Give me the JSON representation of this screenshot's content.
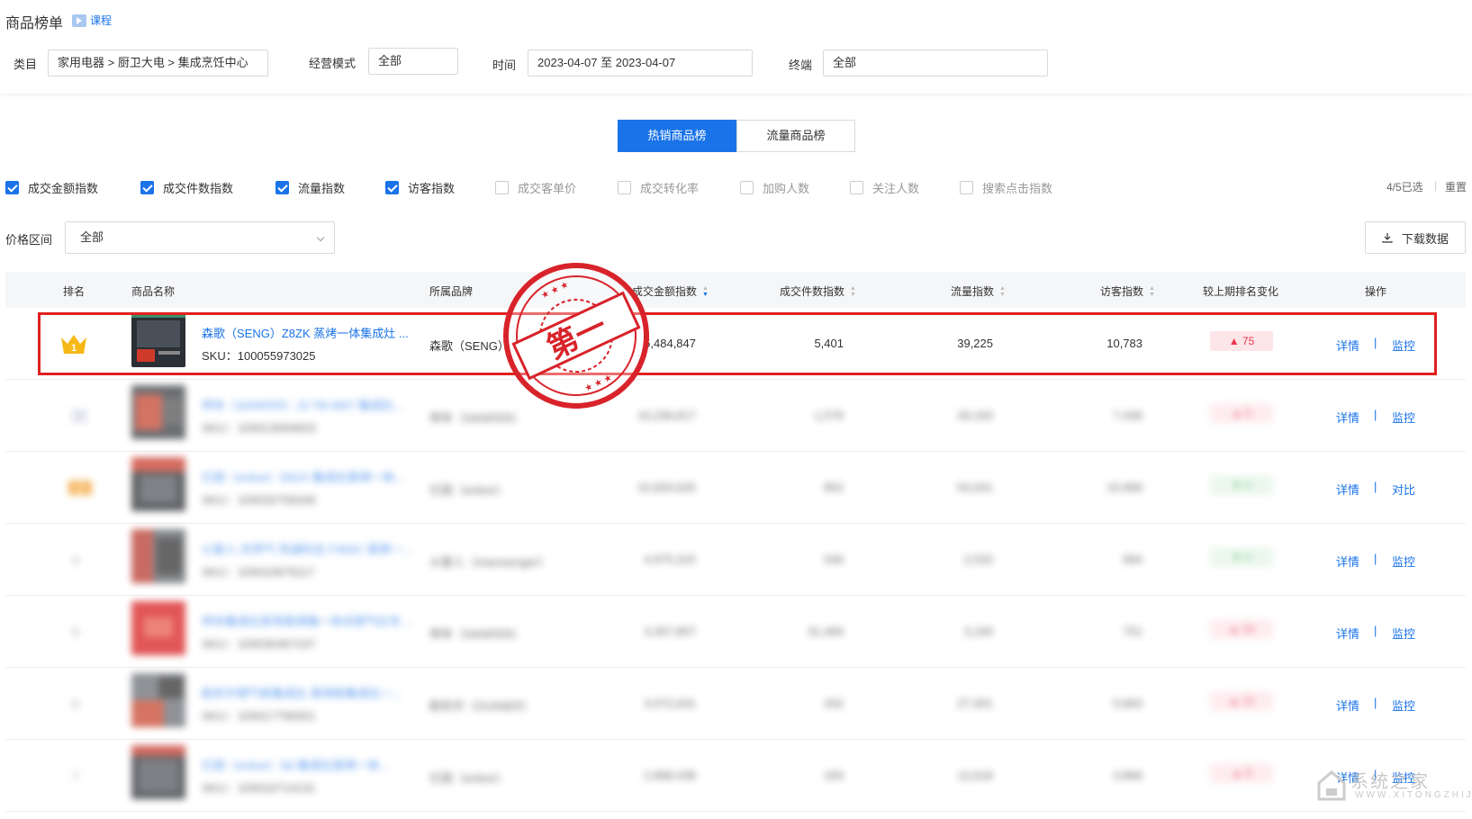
{
  "header": {
    "title": "商品榜单",
    "course_link": "课程"
  },
  "filters": {
    "category_label": "类目",
    "category_value": "家用电器 > 厨卫大电 > 集成烹饪中心",
    "mode_label": "经营模式",
    "mode_value": "全部",
    "time_label": "时间",
    "time_value": "2023-04-07 至 2023-04-07",
    "terminal_label": "终端",
    "terminal_value": "全部"
  },
  "tabs": [
    {
      "label": "热销商品榜",
      "active": true
    },
    {
      "label": "流量商品榜",
      "active": false
    }
  ],
  "metrics": [
    {
      "label": "成交金额指数",
      "checked": true
    },
    {
      "label": "成交件数指数",
      "checked": true
    },
    {
      "label": "流量指数",
      "checked": true
    },
    {
      "label": "访客指数",
      "checked": true
    },
    {
      "label": "成交客单价",
      "checked": false
    },
    {
      "label": "成交转化率",
      "checked": false
    },
    {
      "label": "加购人数",
      "checked": false
    },
    {
      "label": "关注人数",
      "checked": false
    },
    {
      "label": "搜索点击指数",
      "checked": false
    }
  ],
  "selection": {
    "count": "4/5已选",
    "separator": "|",
    "reset": "重置"
  },
  "price": {
    "label": "价格区间",
    "value": "全部"
  },
  "download": {
    "label": "下载数据",
    "icon": "download-icon"
  },
  "table": {
    "headers": [
      "排名",
      "商品名称",
      "所属品牌",
      "成交金额指数",
      "成交件数指数",
      "流量指数",
      "访客指数",
      "较上期排名变化",
      "操作"
    ],
    "rows": [
      {
        "rank": "1",
        "name": "森歌（SENG）Z8ZK 蒸烤一体集成灶 ...",
        "sku": "SKU：100055973025",
        "brand": "森歌（SENG）",
        "amount": "5,484,847",
        "count": "5,401",
        "traffic": "39,225",
        "visitors": "10,783",
        "change": "▲ 75",
        "dir": "up",
        "detail": "详情",
        "pipe": "|",
        "action": "监控"
      },
      {
        "rank": "2",
        "name": "帅丰（SANFER）J2-TB-W07 集成灶...",
        "sku": "SKU：100013094603",
        "brand": "帅丰（SANFER）",
        "amount": "16,236,817",
        "count": "1,576",
        "traffic": "29,163",
        "visitors": "7,436",
        "change": "▲ 5",
        "dir": "up",
        "detail": "详情",
        "pipe": "|",
        "action": "监控"
      },
      {
        "rank": "3",
        "name": "亿田（entive）D62X 集成灶蒸烤一体...",
        "sku": "SKU：100032756349",
        "brand": "亿田（entive）",
        "amount": "10,920,625",
        "count": "852",
        "traffic": "54,041",
        "visitors": "15,999",
        "change": "▼ 2",
        "dir": "down",
        "detail": "详情",
        "pipe": "|",
        "action": "对比"
      },
      {
        "rank": "4",
        "name": "火星人 天然气 风道科全 F300C 蒸烤一...",
        "sku": "SKU：100010679117",
        "brand": "火星人（marssenger）",
        "amount": "4,975,315",
        "count": "546",
        "traffic": "2,520",
        "visitors": "994",
        "change": "▼ 2",
        "dir": "down",
        "detail": "详情",
        "pipe": "|",
        "action": "监控"
      },
      {
        "rank": "5",
        "name": "帅丰集成灶家用蒸烤箱一体式燃气灶专用...",
        "sku": "SKU：100035467107",
        "brand": "帅丰（SANFER）",
        "amount": "3,357,807",
        "count": "31,466",
        "traffic": "3,194",
        "visitors": "751",
        "change": "▲ 34",
        "dir": "up",
        "detail": "详情",
        "pipe": "|",
        "action": "监控"
      },
      {
        "rank": "6",
        "name": "欧尼尔燃气款集成灶 蒸烤款集成灶一...",
        "sku": "SKU：100017796301",
        "brand": "欧尼尔（OUNIER）",
        "amount": "3,072,631",
        "count": "432",
        "traffic": "27,301",
        "visitors": "5,663",
        "change": "▲ 22",
        "dir": "up",
        "detail": "详情",
        "pipe": "|",
        "action": "监控"
      },
      {
        "rank": "7",
        "name": "亿田（entive）S6 集成灶蒸烤一体...",
        "sku": "SKU：100016714131",
        "brand": "亿田（entive）",
        "amount": "2,898,438",
        "count": "183",
        "traffic": "12,618",
        "visitors": "3,866",
        "change": "▲ 9",
        "dir": "up",
        "detail": "详情",
        "pipe": "|",
        "action": "监控"
      }
    ]
  },
  "stamp": {
    "text": "第一"
  },
  "watermark": {
    "main": "系统之家",
    "sub": "WWW.XITONGZHIJIA.NET"
  },
  "colors": {
    "accent": "#1a73e8",
    "up": "#e8364b",
    "down": "#3bb55a",
    "highlight": "#e02020"
  }
}
